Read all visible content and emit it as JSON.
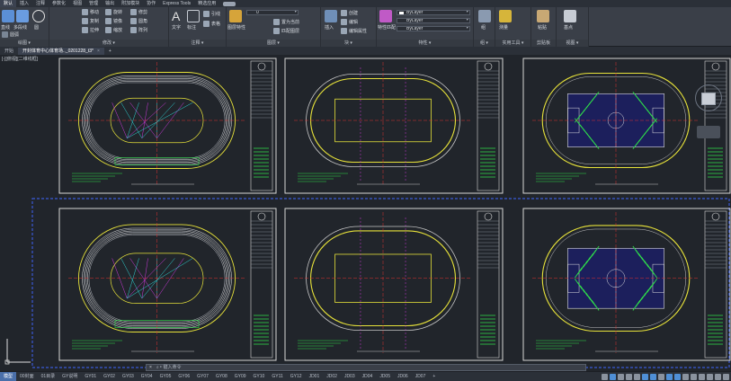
{
  "ribbon_tabs": [
    "默认",
    "插入",
    "注释",
    "参数化",
    "视图",
    "管理",
    "输出",
    "附加模块",
    "协作",
    "Express Tools",
    "精选应用"
  ],
  "ribbon_active_tab": 0,
  "panels": {
    "draw": {
      "label": "绘图 ▾",
      "line": "直线",
      "polyline": "多段线",
      "circle": "圆",
      "arc": "圆弧"
    },
    "modify": {
      "label": "修改 ▾",
      "move": "移动",
      "rotate": "旋转",
      "trim": "修剪",
      "copy": "复制",
      "mirror": "镜像",
      "fillet": "圆角",
      "stretch": "拉伸",
      "scale": "缩放",
      "array": "阵列"
    },
    "annotation": {
      "label": "注释 ▾",
      "text": "文字",
      "dimension": "标注",
      "leader": "引线",
      "table": "表格"
    },
    "layers": {
      "label": "图层 ▾",
      "layer_props": "图层特性",
      "current_layer": "0",
      "make_current": "置为当前",
      "match_layer": "匹配图层"
    },
    "block": {
      "label": "块 ▾",
      "insert": "插入",
      "create": "创建",
      "edit": "编辑",
      "edit_attr": "编辑属性"
    },
    "properties": {
      "label": "特性 ▾",
      "match": "特性匹配",
      "color": "ByLayer",
      "linetype": "ByLayer",
      "lineweight": "ByLayer"
    },
    "groups": {
      "label": "组 ▾",
      "group": "组"
    },
    "utilities": {
      "label": "实用工具 ▾",
      "measure": "测量"
    },
    "clipboard": {
      "label": "剪贴板",
      "paste": "粘贴"
    },
    "view": {
      "label": "视图 ▾",
      "base": "基点"
    }
  },
  "file_tabs": [
    {
      "label": "开始",
      "active": false
    },
    {
      "label": "开封体育中心体育场.._0201228_t3*",
      "active": true
    },
    {
      "label": "+",
      "active": false
    }
  ],
  "viewport_label": "[-][俯视][二维线框]",
  "command_placeholder": "键入命令",
  "layout_tabs": [
    "模型",
    "00封面",
    "01目录",
    "GY说明",
    "GY01",
    "GY02",
    "GY03",
    "GY04",
    "GY05",
    "GY06",
    "GY07",
    "GY08",
    "GY09",
    "GY10",
    "GY11",
    "GY12",
    "JD01",
    "JD02",
    "JD03",
    "JD04",
    "JD05",
    "JD06",
    "JD07",
    "+"
  ],
  "layout_active": 0,
  "status_model_label": "模型",
  "colors": {
    "sheet_border": "#d6d6d6",
    "track_outline": "#e7e23a",
    "field_fill": "#1c1f5c",
    "accent_green": "#2fe04a",
    "accent_red": "#e03030",
    "accent_cyan": "#2fd6d6",
    "accent_magenta": "#d03adf",
    "layout_active": "#4a6faa",
    "selection_blue": "#3a5ad6"
  }
}
